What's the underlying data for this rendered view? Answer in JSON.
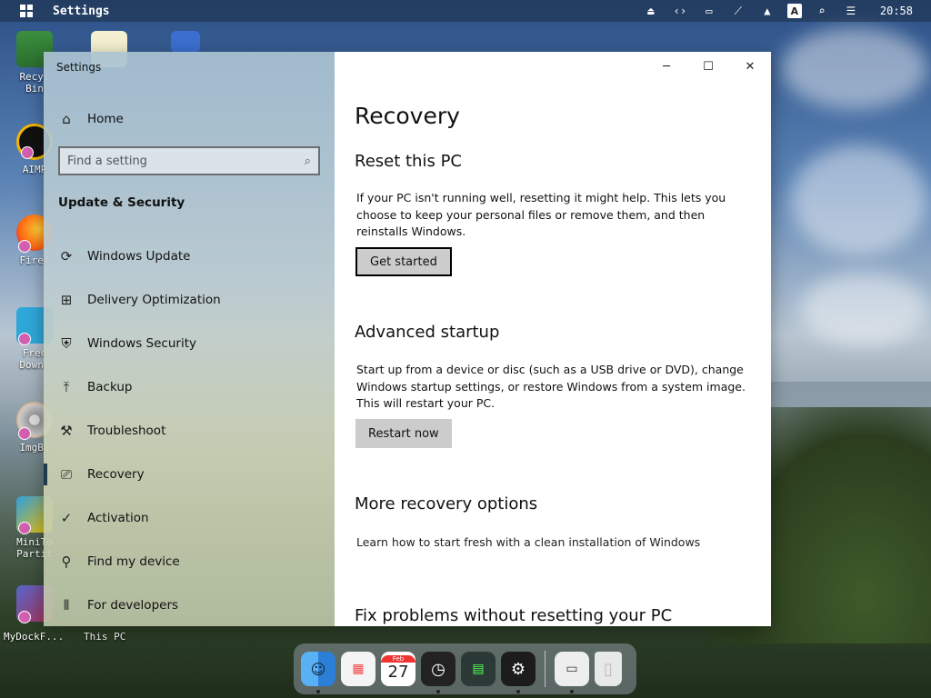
{
  "topbar": {
    "app_title": "Settings",
    "clock": "20:58",
    "tray_letter": "A",
    "tray_icons": [
      "eject-icon",
      "code-icon",
      "monitor-icon",
      "network-off-icon",
      "upload-icon",
      "input-language-icon",
      "search-icon",
      "toggle-icon"
    ]
  },
  "desktop": {
    "icons": [
      {
        "label": "Recyc\nBin",
        "name": "recycle-bin"
      },
      {
        "label": "AIMP",
        "name": "aimp"
      },
      {
        "label": "Firef",
        "name": "firefox"
      },
      {
        "label": "Free\nDownl",
        "name": "free-download-manager"
      },
      {
        "label": "ImgBu",
        "name": "imgburn"
      },
      {
        "label": "MiniTo\nPartit",
        "name": "minitool-partition"
      }
    ],
    "bottom_labels": [
      "MyDockF...",
      "This PC"
    ]
  },
  "window": {
    "title": "Settings",
    "sidebar": {
      "home_label": "Home",
      "search_placeholder": "Find a setting",
      "section_label": "Update & Security",
      "items": [
        {
          "label": "Windows Update",
          "icon": "refresh-icon"
        },
        {
          "label": "Delivery Optimization",
          "icon": "delivery-icon"
        },
        {
          "label": "Windows Security",
          "icon": "shield-icon"
        },
        {
          "label": "Backup",
          "icon": "upload-arrow-icon"
        },
        {
          "label": "Troubleshoot",
          "icon": "wrench-icon"
        },
        {
          "label": "Recovery",
          "icon": "recovery-icon"
        },
        {
          "label": "Activation",
          "icon": "check-circle-icon"
        },
        {
          "label": "Find my device",
          "icon": "person-locate-icon"
        },
        {
          "label": "For developers",
          "icon": "developer-icon"
        }
      ],
      "active_index": 5
    },
    "content": {
      "title": "Recovery",
      "reset": {
        "heading": "Reset this PC",
        "text": "If your PC isn't running well, resetting it might help. This lets you choose to keep your personal files or remove them, and then reinstalls Windows.",
        "button": "Get started"
      },
      "advanced": {
        "heading": "Advanced startup",
        "text": "Start up from a device or disc (such as a USB drive or DVD), change Windows startup settings, or restore Windows from a system image. This will restart your PC.",
        "button": "Restart now"
      },
      "more": {
        "heading": "More recovery options",
        "link": "Learn how to start fresh with a clean installation of Windows"
      },
      "fix": {
        "heading": "Fix problems without resetting your PC"
      }
    }
  },
  "dock": {
    "calendar_month": "Feb",
    "calendar_day": "27",
    "items": [
      "finder-icon",
      "launchpad-icon",
      "calendar-icon",
      "clock-icon",
      "activity-monitor-icon",
      "settings-icon",
      "window-icon",
      "trash-icon"
    ]
  }
}
